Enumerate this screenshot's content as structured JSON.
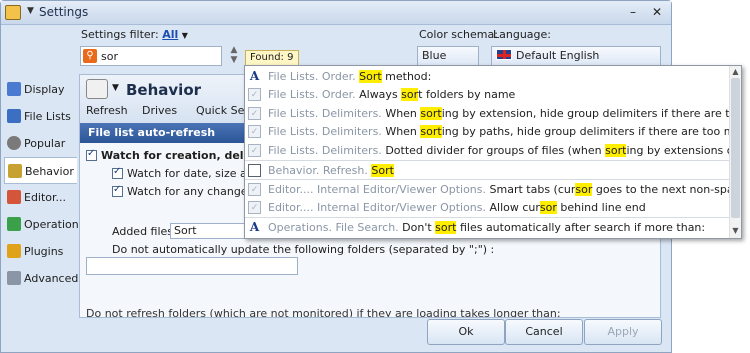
{
  "window": {
    "title": "Settings",
    "minimize": "–",
    "close": "✕"
  },
  "filter": {
    "label": "Settings filter:",
    "value": "All",
    "search_value": "sor",
    "found": "Found: 9"
  },
  "color_schema": {
    "label": "Color schema:",
    "value": "Blue"
  },
  "language": {
    "label": "Language:",
    "value": "Default English"
  },
  "sidebar": {
    "items": [
      {
        "label": "Display",
        "icon": "monitor-icon",
        "color": "#4a7bd0"
      },
      {
        "label": "File Lists",
        "icon": "file-list-icon",
        "color": "#3b6fc1"
      },
      {
        "label": "Popular",
        "icon": "gear-icon",
        "color": "#7a7a7a"
      },
      {
        "label": "Behavior",
        "icon": "behavior-icon",
        "color": "#c7a233"
      },
      {
        "label": "Editor...",
        "icon": "editor-icon",
        "color": "#d4553a"
      },
      {
        "label": "Operations",
        "icon": "operations-icon",
        "color": "#3aa04a"
      },
      {
        "label": "Plugins",
        "icon": "plugin-icon",
        "color": "#e0a21a"
      },
      {
        "label": "Advanced",
        "icon": "document-icon",
        "color": "#8a96a6"
      }
    ]
  },
  "behavior": {
    "title": "Behavior",
    "tabs": [
      "Refresh",
      "Drives",
      "Quick Search"
    ],
    "section": "File list auto-refresh",
    "watch_main": "Watch for creation, deletion, and",
    "watch_date": "Watch for date, size and attribute",
    "watch_any": "Watch for any changes wh",
    "added_files_label": "Added files:",
    "added_files_value": "Sort",
    "no_update_label": "Do not automatically update the following folders (separated by \";\") :",
    "bottom_note": "Do not refresh folders (which are not monitored) if they are loading takes longer than:"
  },
  "popup": {
    "rows": [
      {
        "icon": "font",
        "path": "File Lists. Order. ",
        "pre": "",
        "hl": "Sort",
        "post": " method:"
      },
      {
        "icon": "chk",
        "path": "File Lists. Order. ",
        "pre": "Always ",
        "hl": "sor",
        "post": "t folders by name"
      },
      {
        "icon": "chk",
        "path": "File Lists. Delimiters. ",
        "pre": "When ",
        "hl": "sort",
        "post": "ing by extension, hide group delimiters if there are too many"
      },
      {
        "icon": "chk",
        "path": "File Lists. Delimiters. ",
        "pre": "When ",
        "hl": "sort",
        "post": "ing by paths, hide group delimiters if there are too many"
      },
      {
        "icon": "chk",
        "path": "File Lists. Delimiters. ",
        "pre": "Dotted divider for groups of files (when ",
        "hl": "sort",
        "post": "ing by extensions or paths)"
      },
      {
        "icon": "list",
        "path": "Behavior. Refresh. ",
        "pre": "",
        "hl": "Sort",
        "post": ""
      },
      {
        "icon": "chk",
        "path": "Editor.... Internal Editor/Viewer Options. ",
        "pre": "Smart tabs (cur",
        "hl": "sor",
        "post": " goes to the next non-space character in the prev"
      },
      {
        "icon": "chk",
        "path": "Editor.... Internal Editor/Viewer Options. ",
        "pre": "Allow cur",
        "hl": "sor",
        "post": " behind line end"
      },
      {
        "icon": "font",
        "path": "Operations. File Search. ",
        "pre": "Don't ",
        "hl": "sort",
        "post": " files automatically after search if more than:"
      }
    ]
  },
  "buttons": {
    "ok": "Ok",
    "cancel": "Cancel",
    "apply": "Apply"
  }
}
